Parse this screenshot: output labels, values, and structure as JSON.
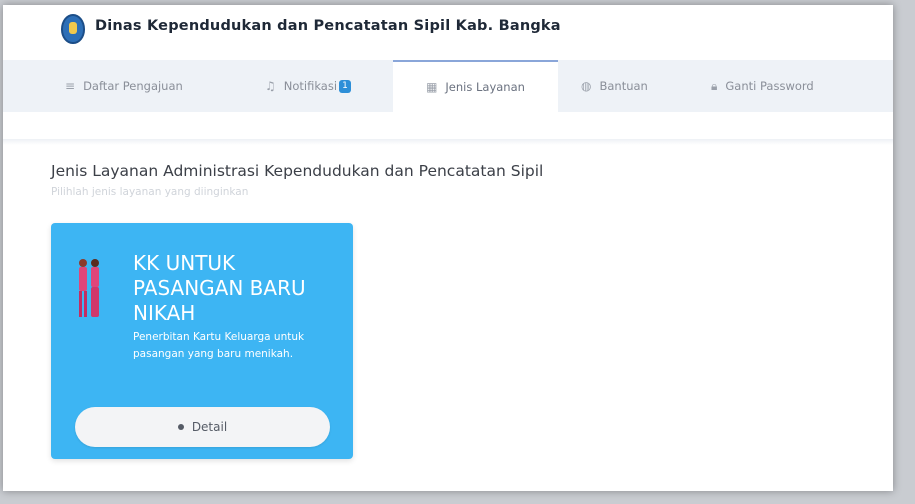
{
  "app": {
    "title": "Dinas Kependudukan dan Pencatatan Sipil Kab. Bangka"
  },
  "nav": {
    "items": [
      {
        "label": "Daftar Pengajuan",
        "icon": "list-icon"
      },
      {
        "label": "Notifikasi",
        "icon": "bell-icon",
        "badge": "1"
      },
      {
        "label": "Jenis Layanan",
        "icon": "grid-icon",
        "active": true
      },
      {
        "label": "Bantuan",
        "icon": "globe-icon"
      },
      {
        "label": "Ganti Password",
        "icon": "lock-icon"
      }
    ]
  },
  "main": {
    "heading": "Jenis Layanan Administrasi Kependudukan dan Pencatatan Sipil",
    "subheading": "Pilihlah jenis layanan yang diinginkan"
  },
  "card": {
    "title": "KK UNTUK PASANGAN BARU NIKAH",
    "description": "Penerbitan Kartu Keluarga untuk pasangan yang baru menikah.",
    "button_label": "Detail",
    "color": "#3db5f3"
  },
  "colors": {
    "accent": "#3db5f3",
    "nav_bg": "#eef2f7",
    "active_tab_border": "#8aa6d9"
  }
}
